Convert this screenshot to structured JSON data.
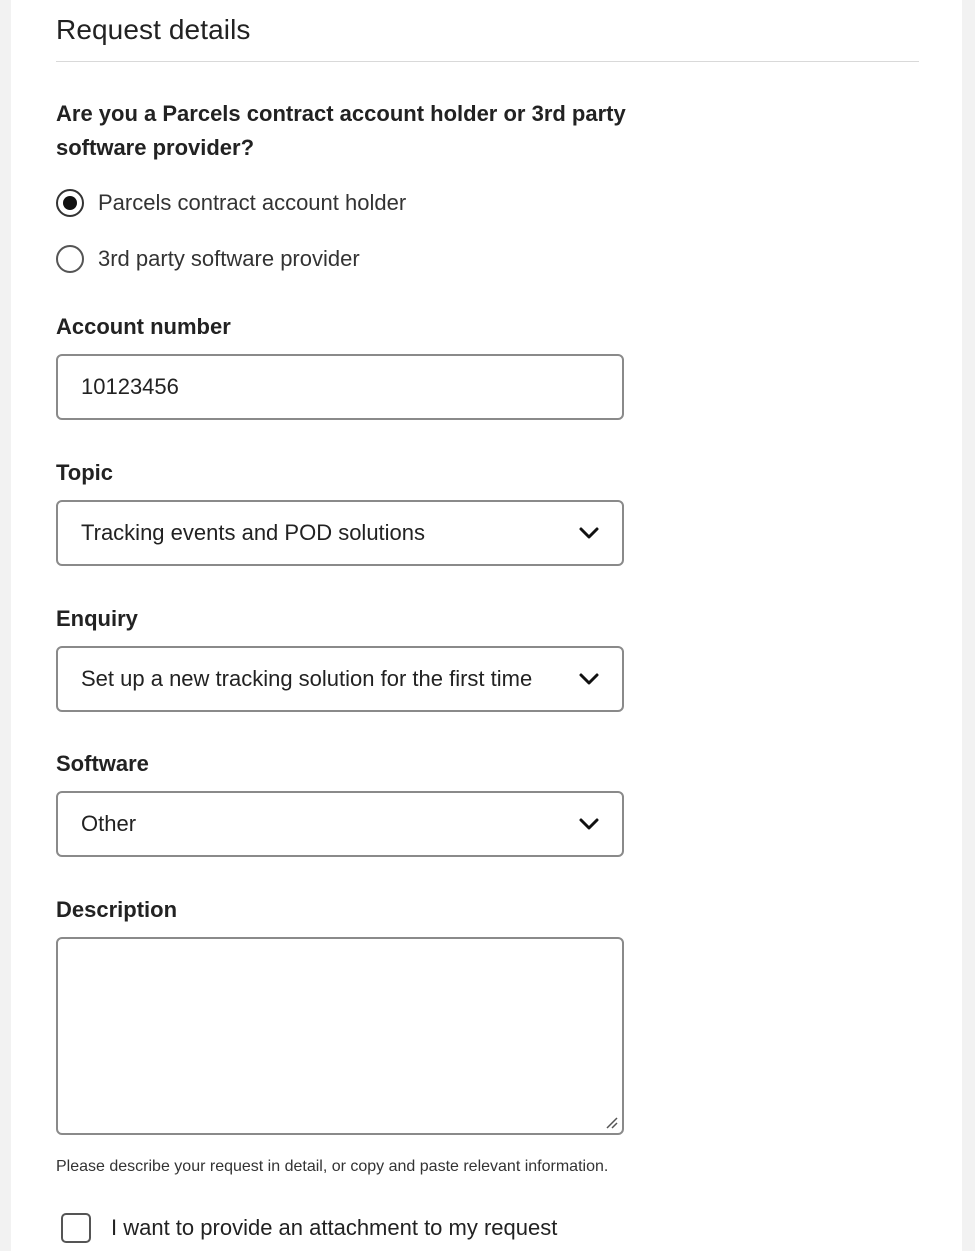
{
  "section": {
    "title": "Request details"
  },
  "account_type": {
    "question": "Are you a Parcels contract account holder or 3rd party software provider?",
    "options": [
      {
        "label": "Parcels contract account holder",
        "selected": true
      },
      {
        "label": "3rd party software provider",
        "selected": false
      }
    ]
  },
  "account_number": {
    "label": "Account number",
    "value": "10123456"
  },
  "topic": {
    "label": "Topic",
    "value": "Tracking events and POD solutions",
    "icon": "chevron-down-icon"
  },
  "enquiry": {
    "label": "Enquiry",
    "value": "Set up a new tracking solution for the first time",
    "icon": "chevron-down-icon"
  },
  "software": {
    "label": "Software",
    "value": "Other",
    "icon": "chevron-down-icon"
  },
  "description": {
    "label": "Description",
    "value": "",
    "hint": "Please describe your request in detail, or copy and paste relevant information."
  },
  "attachment": {
    "label": "I want to provide an attachment to my request",
    "checked": false
  }
}
